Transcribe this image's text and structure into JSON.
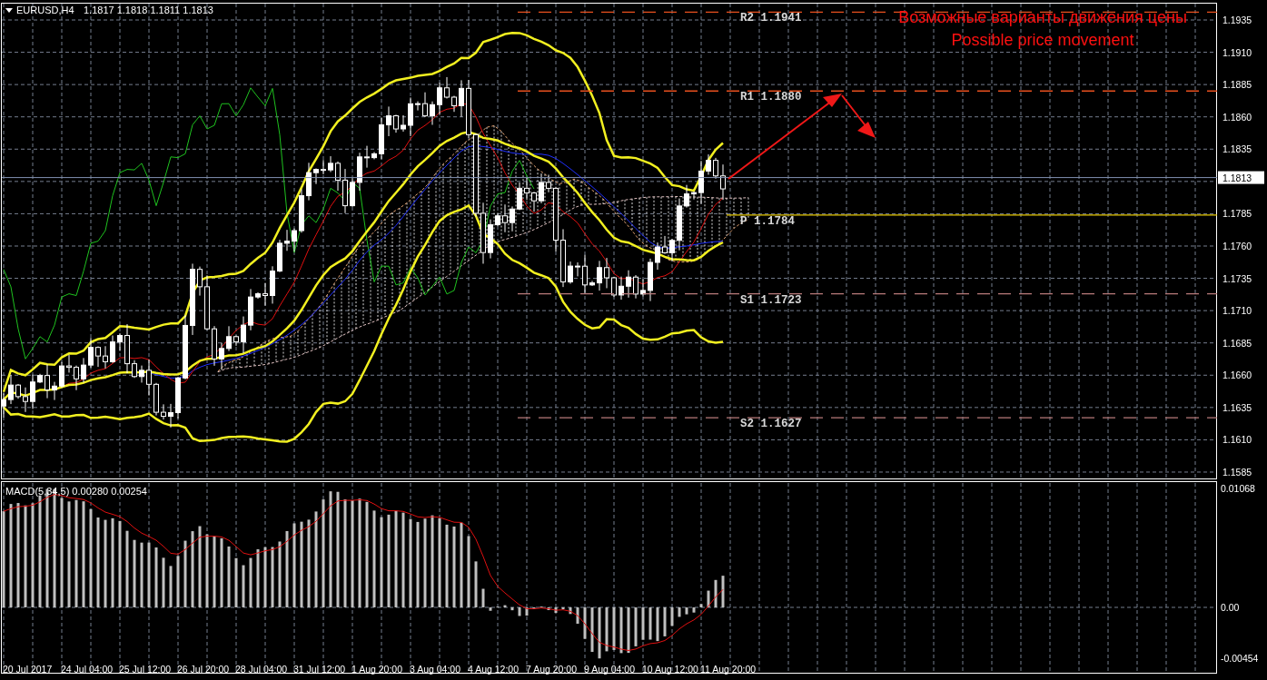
{
  "header": {
    "symbol": "EURUSD,H4",
    "ohlc": [
      "1.1817",
      "1.1818",
      "1.1811",
      "1.1813"
    ]
  },
  "annotation": {
    "lines": [
      "Возможные варианты движения цены",
      "Possible price movement"
    ]
  },
  "levels": [
    {
      "label": "R2",
      "price": "1.1941",
      "kind": "resistance"
    },
    {
      "label": "R1",
      "price": "1.1880",
      "kind": "resistance"
    },
    {
      "label": "P",
      "price": "1.1784",
      "kind": "pivot"
    },
    {
      "label": "S1",
      "price": "1.1723",
      "kind": "support"
    },
    {
      "label": "S2",
      "price": "1.1627",
      "kind": "support"
    }
  ],
  "price_axis": [
    "1.1935",
    "1.1910",
    "1.1885",
    "1.1860",
    "1.1835",
    "1.1785",
    "1.1760",
    "1.1735",
    "1.1710",
    "1.1685",
    "1.1660",
    "1.1635",
    "1.1610",
    "1.1585"
  ],
  "current_price": "1.1813",
  "macd": {
    "label": "MACD(5,34,5) 0.00280 0.00254",
    "axis": [
      "0.01068",
      "0.00",
      "-0.00454"
    ]
  },
  "time_axis": [
    "20 Jul 2017",
    "24 Jul 04:00",
    "25 Jul 12:00",
    "26 Jul 20:00",
    "28 Jul 04:00",
    "31 Jul 12:00",
    "1 Aug 20:00",
    "3 Aug 04:00",
    "4 Aug 12:00",
    "7 Aug 20:00",
    "9 Aug 04:00",
    "10 Aug 12:00",
    "11 Aug 20:00"
  ]
}
